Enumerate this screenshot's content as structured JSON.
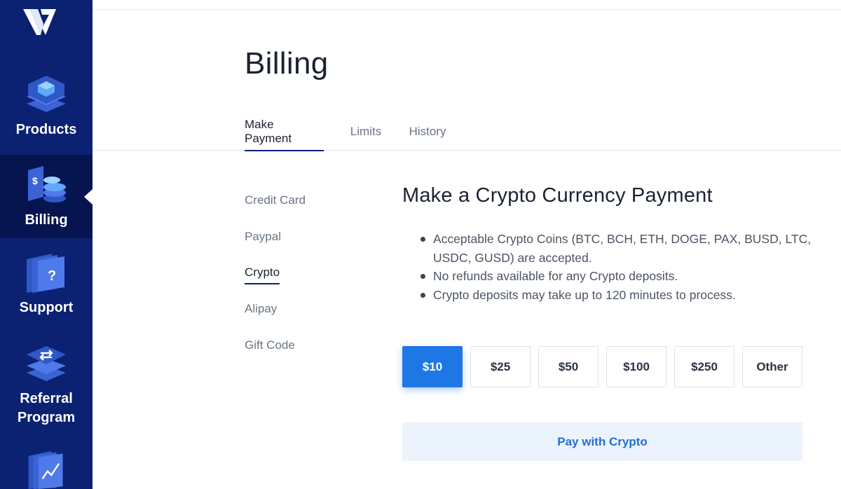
{
  "sidebar": {
    "logo_icon": "vultr-logo-icon",
    "items": [
      {
        "label": "Products",
        "icon": "cube-stack-icon"
      },
      {
        "label": "Billing",
        "icon": "dollar-coins-icon",
        "active": true
      },
      {
        "label": "Support",
        "icon": "question-stack-icon"
      },
      {
        "label": "Referral Program",
        "icon": "exchange-stack-icon"
      },
      {
        "label": "",
        "icon": "chart-stack-icon"
      }
    ]
  },
  "page": {
    "title": "Billing"
  },
  "tabs": [
    {
      "label": "Make Payment",
      "active": true
    },
    {
      "label": "Limits"
    },
    {
      "label": "History"
    }
  ],
  "methods": [
    {
      "label": "Credit Card"
    },
    {
      "label": "Paypal"
    },
    {
      "label": "Crypto",
      "active": true
    },
    {
      "label": "Alipay"
    },
    {
      "label": "Gift Code"
    }
  ],
  "crypto": {
    "title": "Make a Crypto Currency Payment",
    "bullets": [
      "Acceptable Crypto Coins (BTC, BCH, ETH, DOGE, PAX, BUSD, LTC, USDC, GUSD) are accepted.",
      "No refunds available for any Crypto deposits.",
      "Crypto deposits may take up to 120 minutes to process."
    ],
    "amounts": [
      "$10",
      "$25",
      "$50",
      "$100",
      "$250",
      "Other"
    ],
    "selected_amount": "$10",
    "pay_label": "Pay with Crypto"
  },
  "colors": {
    "sidebar_bg": "#0b2172",
    "sidebar_active_bg": "#061550",
    "accent": "#1f77e6",
    "pay_button_bg": "#ebf3fc"
  }
}
